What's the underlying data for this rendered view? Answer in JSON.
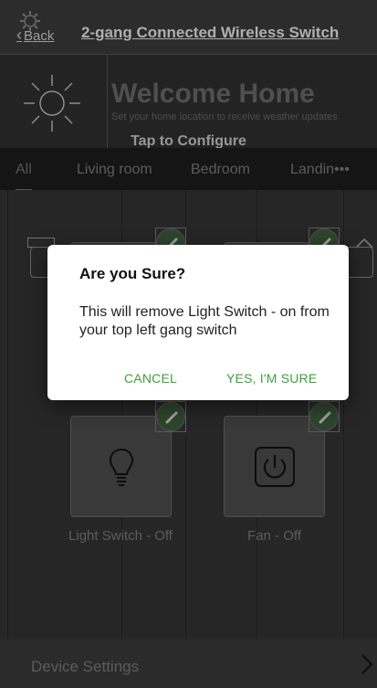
{
  "header": {
    "back_label": "Back",
    "title": "2-gang Connected Wireless Switch"
  },
  "welcome": {
    "title": "Welcome Home",
    "subtitle": "Set your home location to receive weather updates",
    "configure_label": "Tap to Configure"
  },
  "tabs": [
    {
      "label": "All"
    },
    {
      "label": "Living room"
    },
    {
      "label": "Bedroom"
    },
    {
      "label": "Landin"
    }
  ],
  "tiles": [
    {
      "label": "Light Switch - Off",
      "icon": "lightbulb-icon"
    },
    {
      "label": "Fan - Off",
      "icon": "power-icon"
    }
  ],
  "footer": {
    "device_settings_label": "Device Settings"
  },
  "dialog": {
    "title": "Are you Sure?",
    "message": "This will remove Light Switch - on from your top left gang switch",
    "cancel_label": "CANCEL",
    "confirm_label": "YES, I'M SURE"
  },
  "colors": {
    "accent_green": "#3aa33a",
    "dialog_bg": "#ffffff",
    "background": "#2b2b2b"
  }
}
